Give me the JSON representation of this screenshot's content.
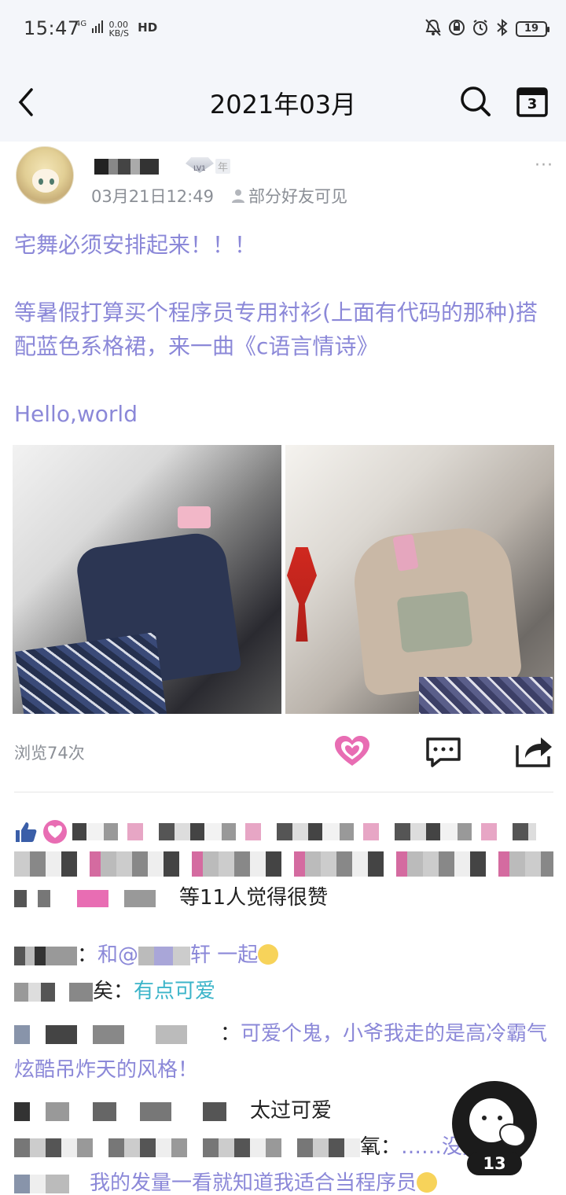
{
  "status_bar": {
    "time": "15:47",
    "network": "4G",
    "speed_value": "0.00",
    "speed_unit": "KB/S",
    "hd": "HD",
    "battery": "19"
  },
  "header": {
    "title": "2021年03月",
    "calendar_day": "3"
  },
  "post": {
    "level": "LV1",
    "year_badge": "年",
    "more": "···",
    "time": "03月21日12:49",
    "visibility": "部分好友可见",
    "text_lines": [
      "宅舞必须安排起来！！！",
      "",
      "等暑假打算买个程序员专用衬衫(上面有代码的那种)搭配蓝色系格裙，来一曲《c语言情诗》",
      "",
      "Hello,world"
    ],
    "views": "浏览74次",
    "likes_summary": "等11人觉得很赞"
  },
  "comments": [
    {
      "prefix": "：",
      "text": "和@",
      "suffix": "轩 一起",
      "style": "blue"
    },
    {
      "prefix": "矣：",
      "text": "有点可爱",
      "style": "cyan"
    },
    {
      "prefix": "：",
      "text": "可爱个鬼，小爷我走的是高冷霸气炫酷吊炸天的风格！",
      "style": "blue"
    },
    {
      "prefix": "",
      "text": "太过可爱",
      "style": "plain"
    },
    {
      "prefix": "氧：",
      "text": "……没完",
      "style": "dots"
    },
    {
      "prefix": "",
      "text": "我的发量一看就知道我适合当程序员",
      "style": "blue"
    }
  ],
  "floating": {
    "message_count": "13"
  },
  "colors": {
    "accent_purple": "#8b88d8",
    "like_pink": "#e86db3",
    "header_bg": "#f4f6fa"
  }
}
